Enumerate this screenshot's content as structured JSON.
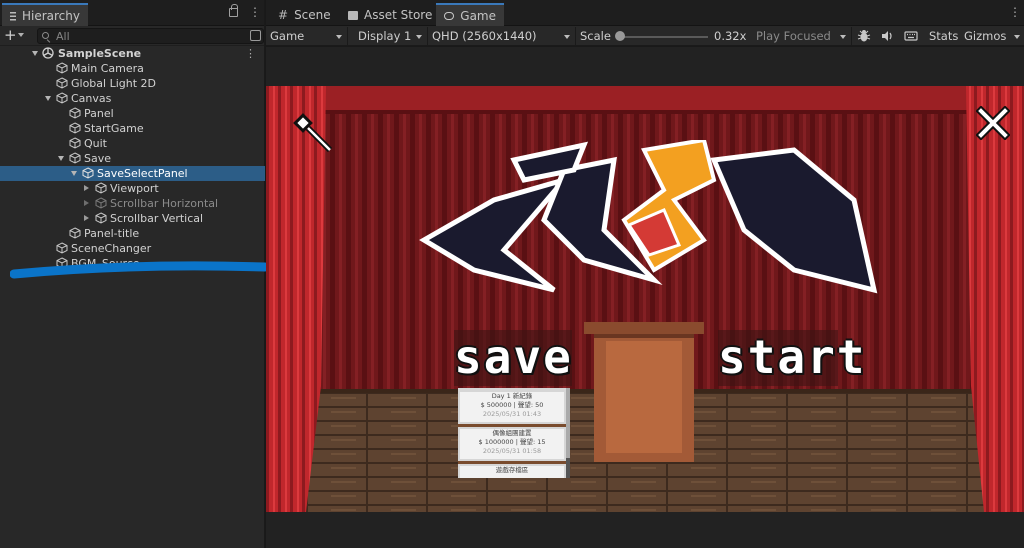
{
  "hierarchy": {
    "tab_label": "Hierarchy",
    "search_placeholder": "All",
    "items": [
      {
        "label": "SampleScene"
      },
      {
        "label": "Main Camera"
      },
      {
        "label": "Global Light 2D"
      },
      {
        "label": "Canvas"
      },
      {
        "label": "Panel"
      },
      {
        "label": "StartGame"
      },
      {
        "label": "Quit"
      },
      {
        "label": "Save"
      },
      {
        "label": "SaveSelectPanel"
      },
      {
        "label": "Viewport"
      },
      {
        "label": "Scrollbar Horizontal"
      },
      {
        "label": "Scrollbar Vertical"
      },
      {
        "label": "Panel-title"
      },
      {
        "label": "SceneChanger"
      },
      {
        "label": "BGM_Source"
      }
    ]
  },
  "editor_tabs": {
    "scene": "Scene",
    "asset_store": "Asset Store",
    "game": "Game"
  },
  "game_toolbar": {
    "view_mode": "Game",
    "display": "Display 1",
    "resolution": "QHD (2560x1440)",
    "scale_label": "Scale",
    "scale_value": "0.32x",
    "scale_fraction": 0.0,
    "play_mode": "Play Focused",
    "stats": "Stats",
    "gizmos": "Gizmos"
  },
  "game": {
    "save_label": "save",
    "start_label": "start",
    "save_slots": [
      {
        "line1": "Day 1 新紀錄",
        "line2": "$ 500000 | 聲望: 50",
        "line3": "2025/05/31 01:43"
      },
      {
        "line1": "偶像組團建置",
        "line2": "$ 1000000 | 聲望: 15",
        "line3": "2025/05/31 01:58"
      },
      {
        "line1": "遊戲存檔區"
      }
    ]
  },
  "colors": {
    "accent_blue": "#2c5d87",
    "curtain_red": "#b3262a",
    "logo_orange": "#f3a020",
    "scribble_blue": "#0a74c9"
  }
}
